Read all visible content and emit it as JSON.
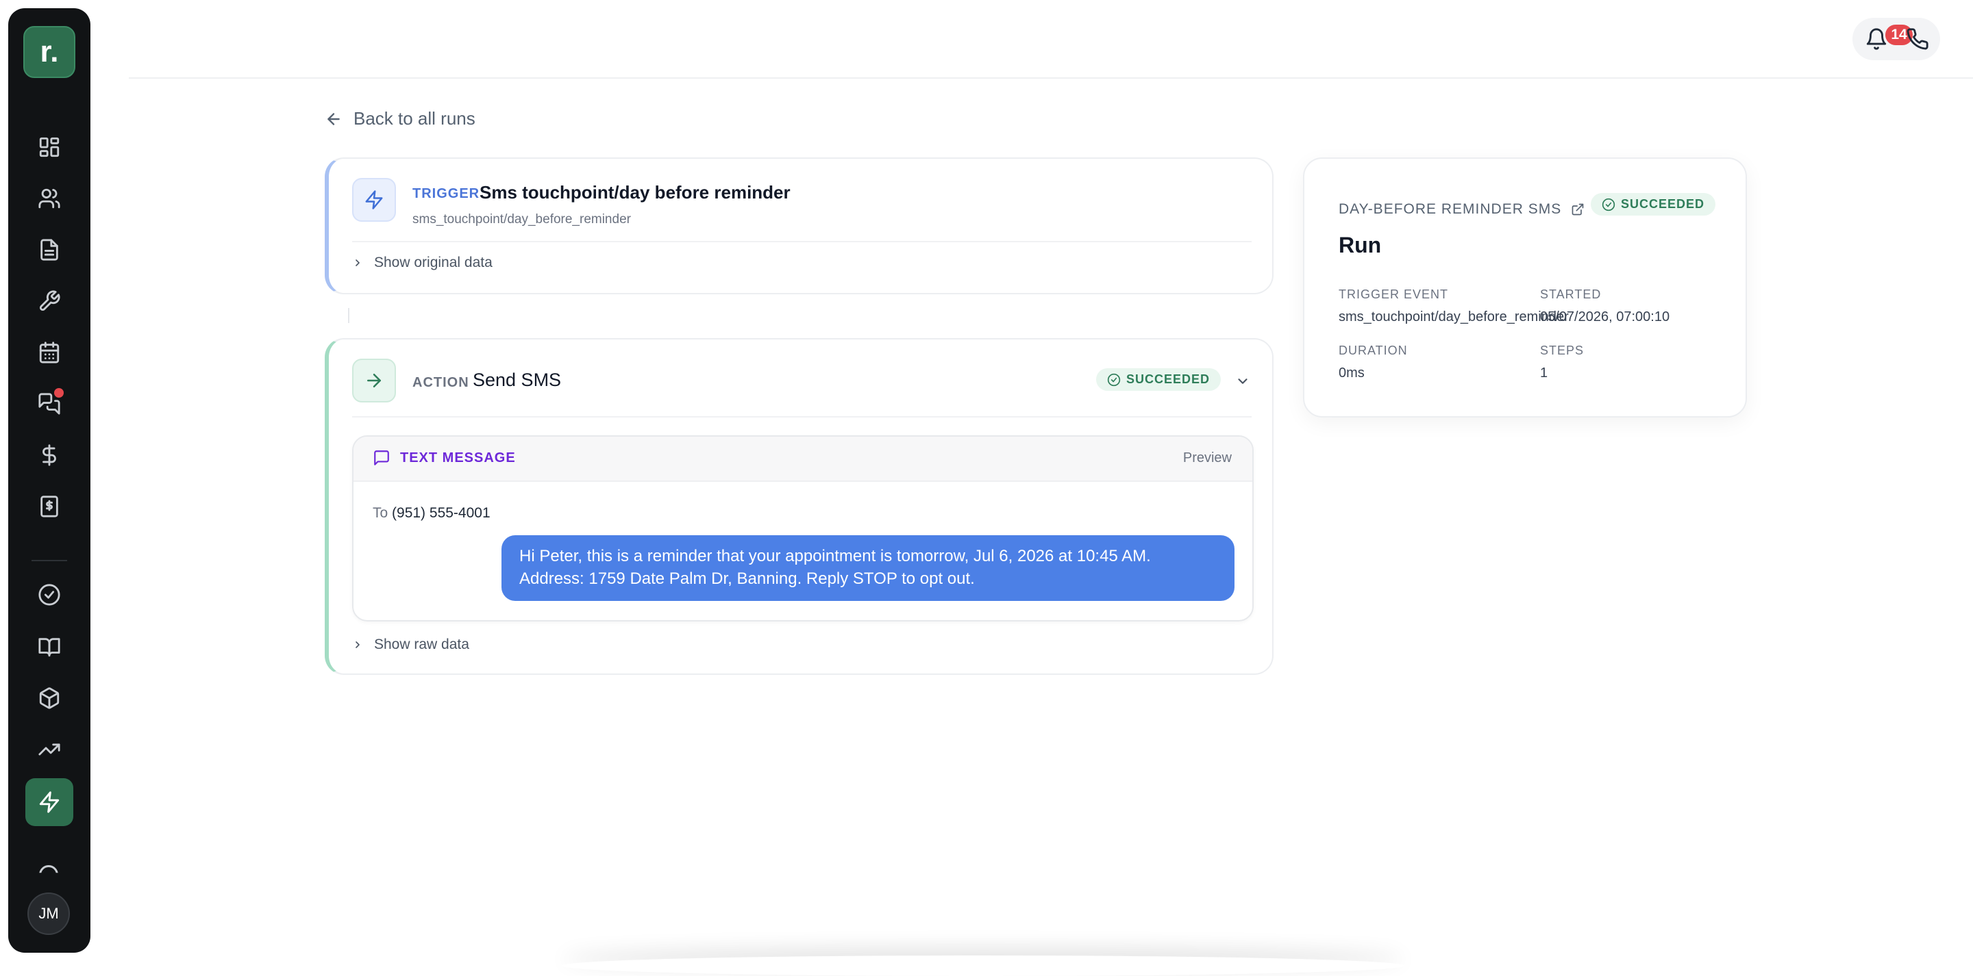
{
  "app": {
    "logo_text": "r.",
    "user_initials": "JM"
  },
  "sidebar": {
    "items": [
      {
        "icon": "dashboard-icon"
      },
      {
        "icon": "users-icon"
      },
      {
        "icon": "document-icon"
      },
      {
        "icon": "wrench-icon"
      },
      {
        "icon": "calendar-icon"
      },
      {
        "icon": "messages-icon",
        "has_dot": true
      },
      {
        "icon": "dollar-icon"
      },
      {
        "icon": "invoice-icon"
      },
      {
        "icon": "check-circle-icon"
      },
      {
        "icon": "book-icon"
      },
      {
        "icon": "package-icon"
      },
      {
        "icon": "trending-icon"
      },
      {
        "icon": "lightning-icon",
        "active": true
      }
    ]
  },
  "header": {
    "notification_count": "14"
  },
  "back_link": "Back to all runs",
  "trigger": {
    "kind": "TRIGGER",
    "title": "Sms touchpoint/day before reminder",
    "event": "sms_touchpoint/day_before_reminder",
    "show_original": "Show original data"
  },
  "action": {
    "kind": "ACTION",
    "title": "Send SMS",
    "status": "SUCCEEDED",
    "message": {
      "label": "TEXT MESSAGE",
      "preview": "Preview",
      "to_label": "To",
      "to_number": "(951) 555-4001",
      "body": "Hi Peter, this is a reminder that your appointment is tomorrow, Jul 6, 2026 at 10:45 AM. Address: 1759 Date Palm Dr, Banning. Reply STOP to opt out."
    },
    "show_raw": "Show raw data"
  },
  "run": {
    "workflow_name": "DAY-BEFORE REMINDER SMS",
    "status": "SUCCEEDED",
    "title": "Run",
    "trigger_event_label": "TRIGGER EVENT",
    "trigger_event_value": "sms_touchpoint/day_before_reminder",
    "started_label": "STARTED",
    "started_value": "05/07/2026, 07:00:10",
    "duration_label": "DURATION",
    "duration_value": "0ms",
    "steps_label": "STEPS",
    "steps_value": "1"
  },
  "colors": {
    "brand_green": "#2d6e4e",
    "bubble_blue": "#4c80e6",
    "success": "#2e7d59",
    "alert_red": "#e5484d"
  }
}
